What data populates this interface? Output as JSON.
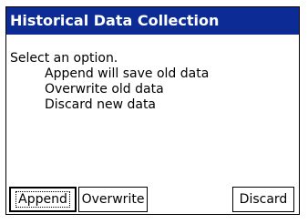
{
  "dialog": {
    "title": "Historical Data Collection",
    "prompt": "Select an option.",
    "options": [
      "Append will save old data",
      "Overwrite old data",
      "Discard new data"
    ]
  },
  "buttons": {
    "append": "Append",
    "overwrite": "Overwrite",
    "discard": "Discard"
  },
  "colors": {
    "titlebar": "#0c2b95",
    "background": "#ffffff"
  }
}
